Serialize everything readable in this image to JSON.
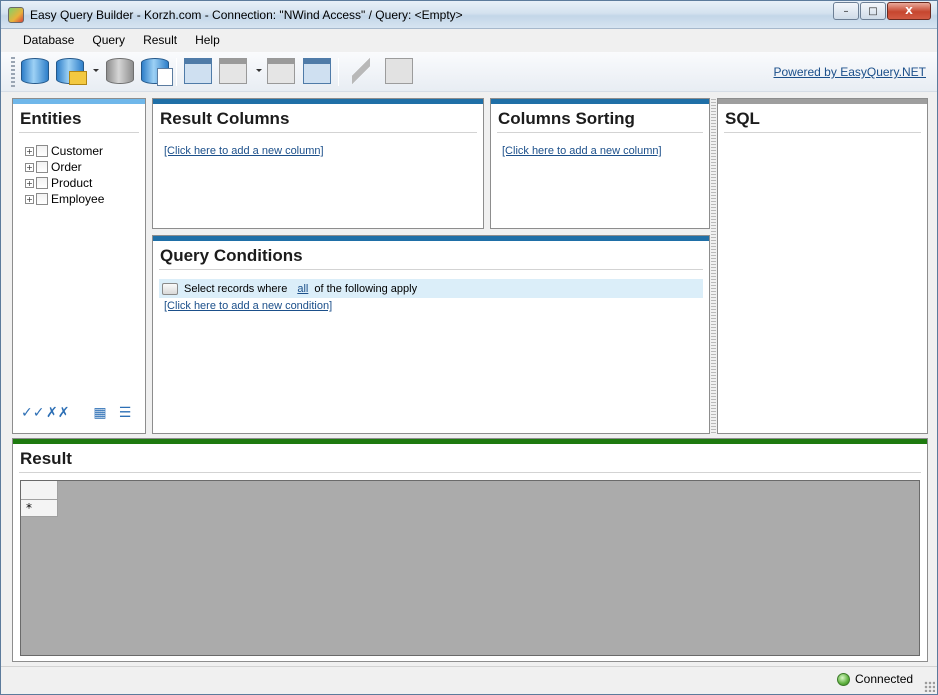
{
  "window": {
    "title": "Easy Query Builder - Korzh.com - Connection: \"NWind Access\" / Query: <Empty>",
    "buttons": {
      "minimize": "–",
      "maximize": "□",
      "close": "X"
    }
  },
  "menu": {
    "items": [
      {
        "label": "Database"
      },
      {
        "label": "Query"
      },
      {
        "label": "Result"
      },
      {
        "label": "Help"
      }
    ]
  },
  "toolbar": {
    "powered_link": "Powered by EasyQuery.NET",
    "buttons": [
      {
        "icon": "database-connect-icon",
        "enabled": true
      },
      {
        "icon": "database-open-icon",
        "enabled": true,
        "dropdown": true
      },
      {
        "icon": "database-gray-icon",
        "enabled": false
      },
      {
        "icon": "database-edit-icon",
        "enabled": true
      },
      {
        "icon": "query-new-icon",
        "enabled": true
      },
      {
        "icon": "query-open-icon",
        "enabled": false,
        "dropdown": true
      },
      {
        "icon": "query-save-icon",
        "enabled": false
      },
      {
        "icon": "query-edit-icon",
        "enabled": true
      },
      {
        "icon": "execute-bolt-icon",
        "enabled": false
      },
      {
        "icon": "copy-icon",
        "enabled": false
      }
    ]
  },
  "entities": {
    "title": "Entities",
    "items": [
      {
        "label": "Customer",
        "expander": "+"
      },
      {
        "label": "Order",
        "expander": "+"
      },
      {
        "label": "Product",
        "expander": "+"
      },
      {
        "label": "Employee",
        "expander": "+"
      }
    ],
    "tools": {
      "check_all": "✓✓",
      "uncheck_all": "✗✗",
      "grid_view": "▦",
      "list_view": "☰"
    }
  },
  "result_columns": {
    "title": "Result Columns",
    "add_link": "[Click here to add a new column]"
  },
  "columns_sorting": {
    "title": "Columns Sorting",
    "add_link": "[Click here to add a new column]"
  },
  "sql": {
    "title": "SQL"
  },
  "query_conditions": {
    "title": "Query Conditions",
    "row_prefix": "Select records where",
    "row_operator": "all",
    "row_suffix": "of the following apply",
    "add_link": "[Click here to add a new condition]"
  },
  "result": {
    "title": "Result",
    "new_row_marker": "*"
  },
  "status": {
    "text": "Connected"
  },
  "colors": {
    "panel_bar": "#1f6fa7",
    "entities_bar": "#6fb7ea",
    "sql_bar": "#9e9e9e",
    "result_bar": "#1e7a0f",
    "link": "#1b4f8a",
    "condition_row": "#dbeef9",
    "grid_background": "#ababab"
  }
}
